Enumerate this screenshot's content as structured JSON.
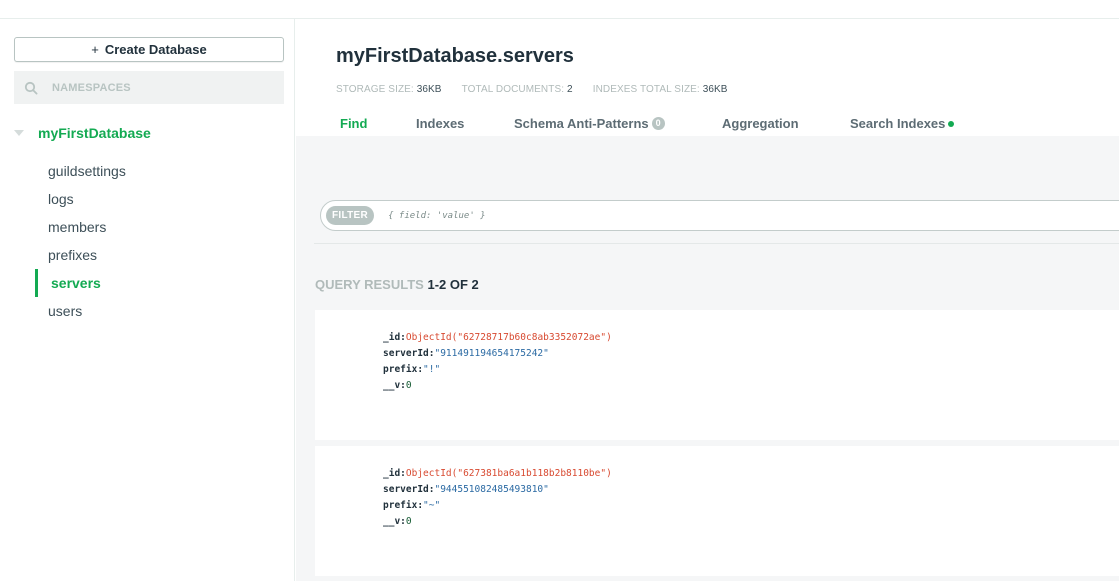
{
  "sidebar": {
    "create_button": "Create Database",
    "search_placeholder": "NAMESPACES",
    "database": "myFirstDatabase",
    "collections": [
      "guildsettings",
      "logs",
      "members",
      "prefixes",
      "servers",
      "users"
    ],
    "active_collection": "servers"
  },
  "main": {
    "title": "myFirstDatabase.servers",
    "stats": {
      "storage_label": "STORAGE SIZE:",
      "storage_value": "36KB",
      "docs_label": "TOTAL DOCUMENTS:",
      "docs_value": "2",
      "indexes_label": "INDEXES TOTAL SIZE:",
      "indexes_value": "36KB"
    },
    "tabs": {
      "find": "Find",
      "indexes": "Indexes",
      "schema": "Schema Anti-Patterns",
      "schema_count": "0",
      "aggregation": "Aggregation",
      "search": "Search Indexes"
    },
    "filter": {
      "label": "FILTER",
      "placeholder": "{ field: 'value' }"
    },
    "results": {
      "label": "QUERY RESULTS",
      "range": "1-2 OF 2"
    },
    "documents": [
      {
        "id_key": "_id:",
        "id_value": "ObjectId(\"62728717b60c8ab3352072ae\")",
        "server_key": "serverId:",
        "server_value": "\"911491194654175242\"",
        "prefix_key": "prefix:",
        "prefix_value": "\"!\"",
        "v_key": "__v:",
        "v_value": "0"
      },
      {
        "id_key": "_id:",
        "id_value": "ObjectId(\"627381ba6a1b118b2b8110be\")",
        "server_key": "serverId:",
        "server_value": "\"944551082485493810\"",
        "prefix_key": "prefix:",
        "prefix_value": "\"~\"",
        "v_key": "__v:",
        "v_value": "0"
      }
    ]
  },
  "colors": {
    "accent": "#13aa52",
    "objectid": "#d84a31",
    "string": "#2b6aa3"
  }
}
